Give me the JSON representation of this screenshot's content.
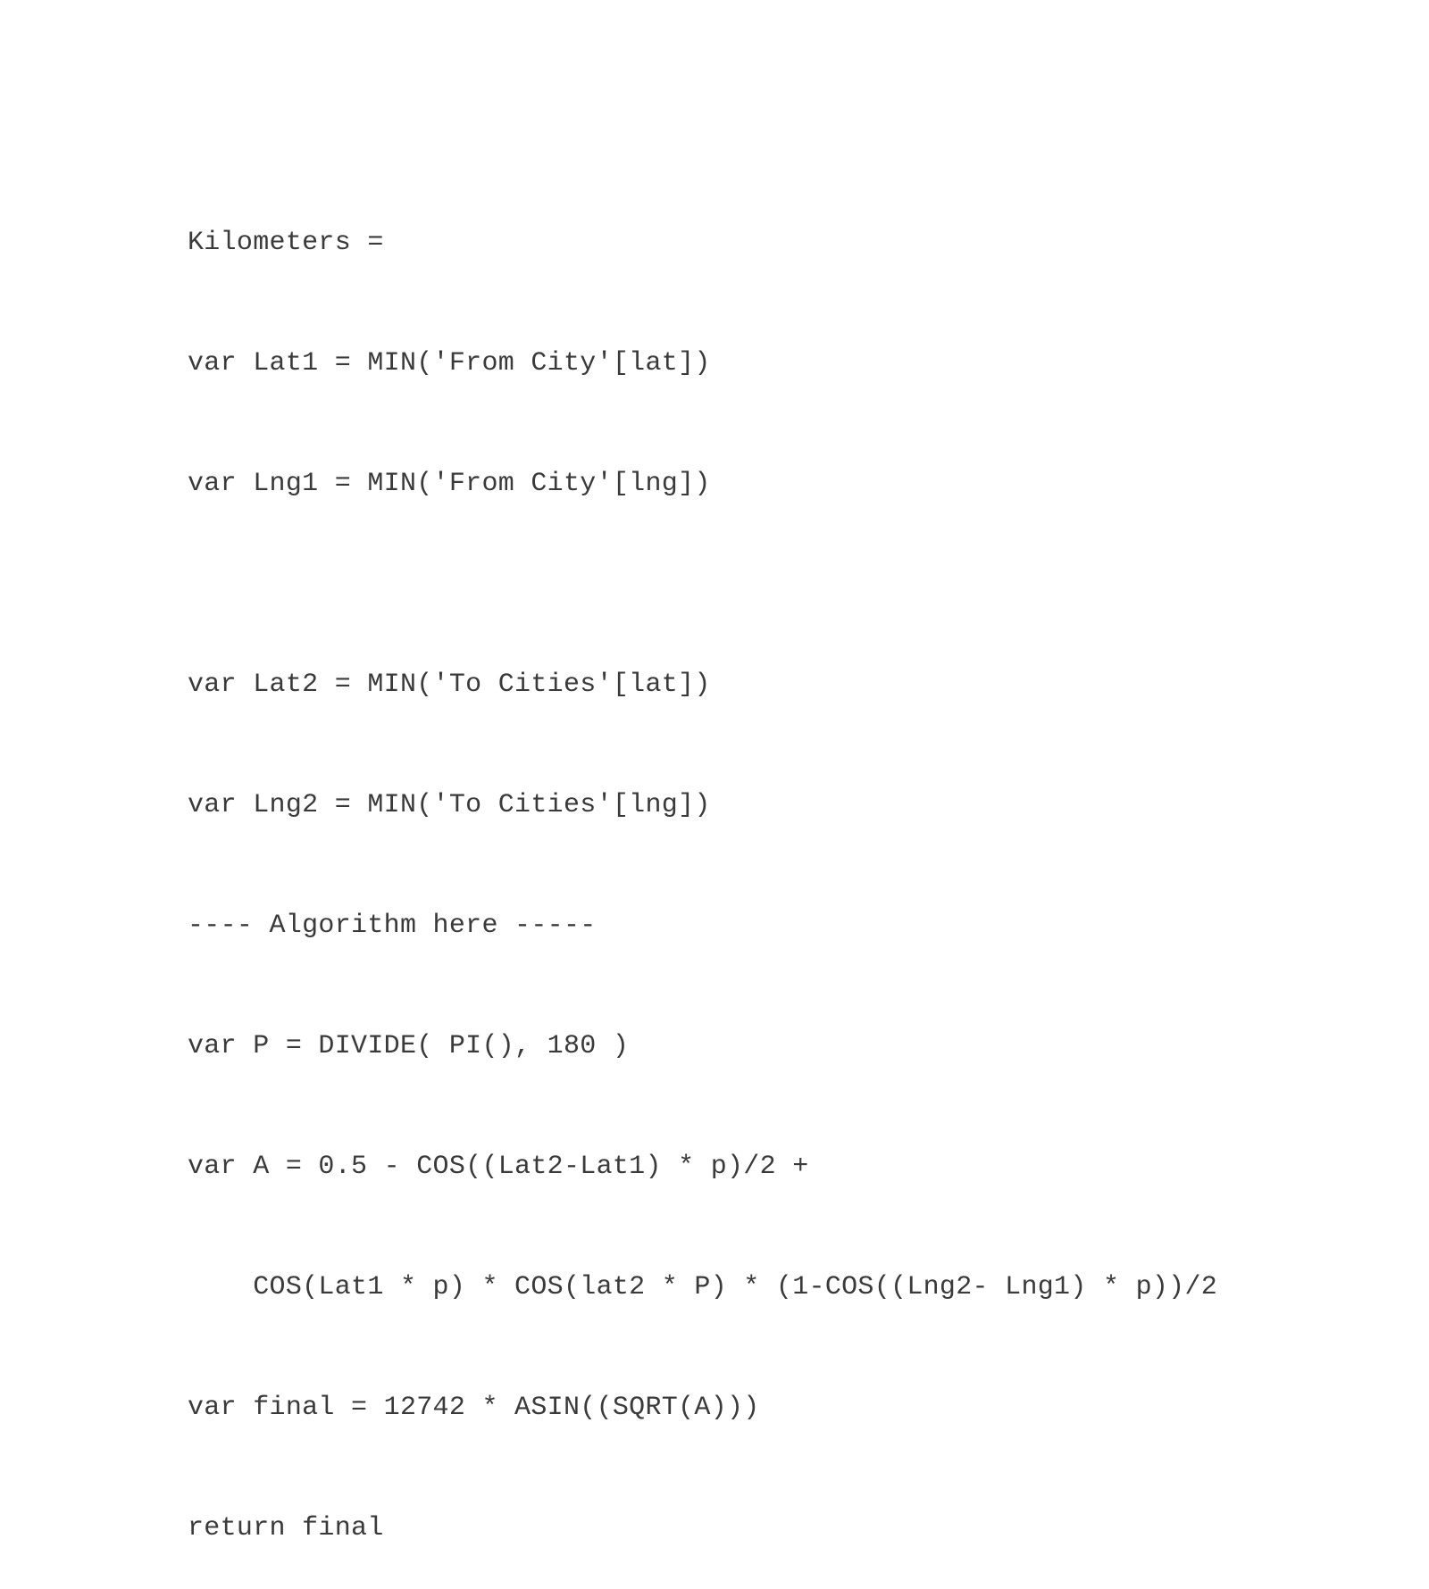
{
  "code": {
    "lines": [
      "Kilometers =",
      "var Lat1 = MIN('From City'[lat])",
      "var Lng1 = MIN('From City'[lng])",
      "",
      "var Lat2 = MIN('To Cities'[lat])",
      "var Lng2 = MIN('To Cities'[lng])",
      "---- Algorithm here -----",
      "var P = DIVIDE( PI(), 180 )",
      "var A = 0.5 - COS((Lat2-Lat1) * p)/2 +",
      "    COS(Lat1 * p) * COS(lat2 * P) * (1-COS((Lng2- Lng1) * p))/2",
      "var final = 12742 * ASIN((SQRT(A)))",
      "return final"
    ]
  }
}
